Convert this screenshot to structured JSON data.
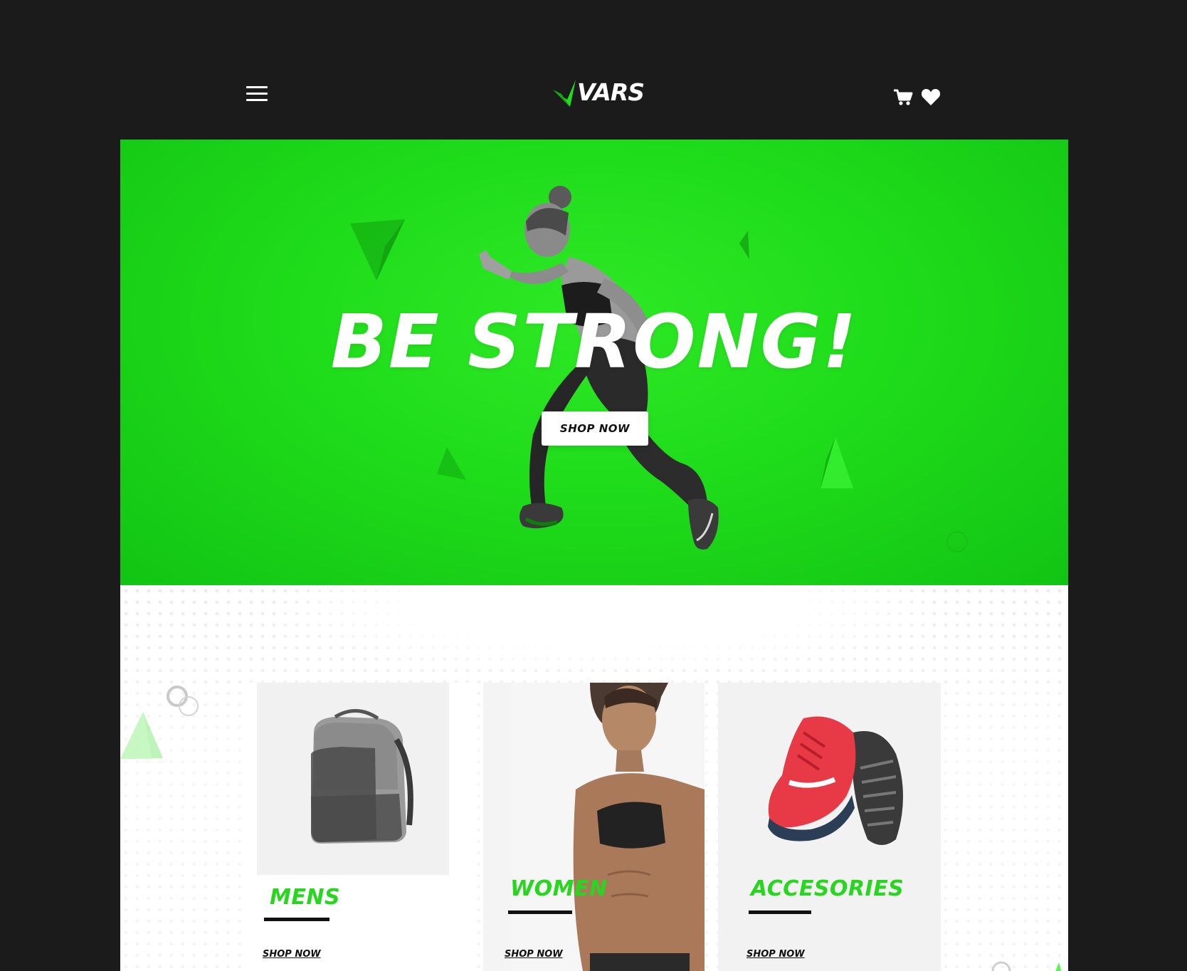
{
  "header": {
    "menu_icon": "hamburger-menu-icon",
    "logo_text": "VARS",
    "cart_icon": "shopping-cart-icon",
    "wishlist_icon": "heart-icon"
  },
  "hero": {
    "title": "BE STRONG!",
    "button_label": "SHOP NOW"
  },
  "categories": [
    {
      "label": "MENS",
      "link": "SHOP NOW"
    },
    {
      "label": "WOMEN",
      "link": "SHOP NOW"
    },
    {
      "label": "ACCESORIES",
      "link": "SHOP NOW"
    }
  ],
  "colors": {
    "background": "#1b1b1c",
    "accent_green": "#22dd1c",
    "label_green": "#28d61f",
    "white": "#ffffff"
  }
}
